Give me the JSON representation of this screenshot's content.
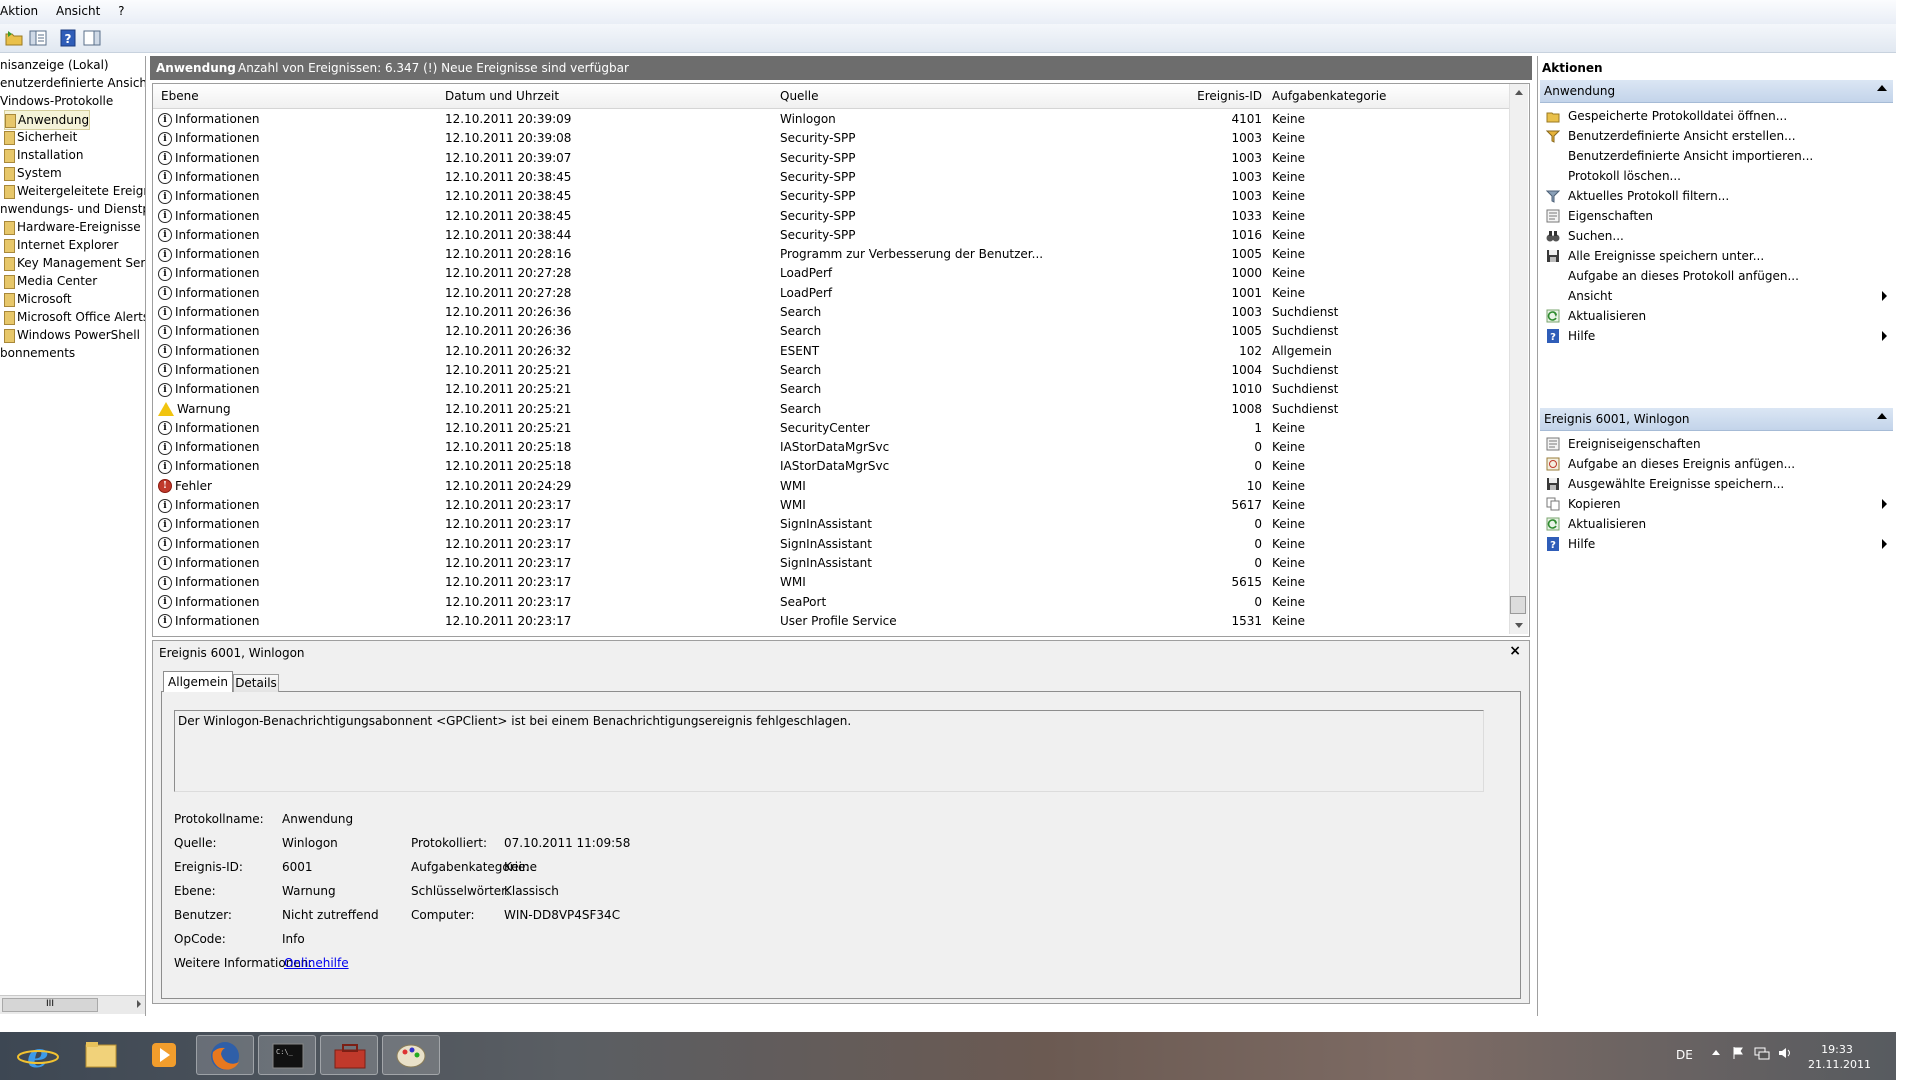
{
  "menu": [
    "Aktion",
    "Ansicht",
    "?"
  ],
  "tree": {
    "items": [
      {
        "label": "nisanzeige (Lokal)",
        "indent": 0
      },
      {
        "label": "enutzerdefinierte Ansichten",
        "indent": 0
      },
      {
        "label": "Vindows-Protokolle",
        "indent": 0
      },
      {
        "label": "Anwendung",
        "indent": 1,
        "selected": true
      },
      {
        "label": "Sicherheit",
        "indent": 1
      },
      {
        "label": "Installation",
        "indent": 1
      },
      {
        "label": "System",
        "indent": 1
      },
      {
        "label": "Weitergeleitete Ereignisse",
        "indent": 1
      },
      {
        "label": "nwendungs- und Dienstprotokolle",
        "indent": 0
      },
      {
        "label": "Hardware-Ereignisse",
        "indent": 1
      },
      {
        "label": "Internet Explorer",
        "indent": 1
      },
      {
        "label": "Key Management Service",
        "indent": 1
      },
      {
        "label": "Media Center",
        "indent": 1
      },
      {
        "label": "Microsoft",
        "indent": 1
      },
      {
        "label": "Microsoft Office Alerts",
        "indent": 1
      },
      {
        "label": "Windows PowerShell",
        "indent": 1
      },
      {
        "label": "bonnements",
        "indent": 0
      }
    ],
    "scroll_glyph": "III"
  },
  "center_header": {
    "title": "Anwendung",
    "info": "Anzahl von Ereignissen: 6.347 (!) Neue Ereignisse sind verfügbar"
  },
  "grid": {
    "columns": [
      "Ebene",
      "Datum und Uhrzeit",
      "Quelle",
      "Ereignis-ID",
      "Aufgabenkategorie"
    ],
    "rows": [
      {
        "level": "Informationen",
        "kind": "info",
        "date": "12.10.2011 20:39:09",
        "source": "Winlogon",
        "id": "4101",
        "cat": "Keine"
      },
      {
        "level": "Informationen",
        "kind": "info",
        "date": "12.10.2011 20:39:08",
        "source": "Security-SPP",
        "id": "1003",
        "cat": "Keine"
      },
      {
        "level": "Informationen",
        "kind": "info",
        "date": "12.10.2011 20:39:07",
        "source": "Security-SPP",
        "id": "1003",
        "cat": "Keine"
      },
      {
        "level": "Informationen",
        "kind": "info",
        "date": "12.10.2011 20:38:45",
        "source": "Security-SPP",
        "id": "1003",
        "cat": "Keine"
      },
      {
        "level": "Informationen",
        "kind": "info",
        "date": "12.10.2011 20:38:45",
        "source": "Security-SPP",
        "id": "1003",
        "cat": "Keine"
      },
      {
        "level": "Informationen",
        "kind": "info",
        "date": "12.10.2011 20:38:45",
        "source": "Security-SPP",
        "id": "1033",
        "cat": "Keine"
      },
      {
        "level": "Informationen",
        "kind": "info",
        "date": "12.10.2011 20:38:44",
        "source": "Security-SPP",
        "id": "1016",
        "cat": "Keine"
      },
      {
        "level": "Informationen",
        "kind": "info",
        "date": "12.10.2011 20:28:16",
        "source": "Programm zur Verbesserung der Benutzer...",
        "id": "1005",
        "cat": "Keine"
      },
      {
        "level": "Informationen",
        "kind": "info",
        "date": "12.10.2011 20:27:28",
        "source": "LoadPerf",
        "id": "1000",
        "cat": "Keine"
      },
      {
        "level": "Informationen",
        "kind": "info",
        "date": "12.10.2011 20:27:28",
        "source": "LoadPerf",
        "id": "1001",
        "cat": "Keine"
      },
      {
        "level": "Informationen",
        "kind": "info",
        "date": "12.10.2011 20:26:36",
        "source": "Search",
        "id": "1003",
        "cat": "Suchdienst"
      },
      {
        "level": "Informationen",
        "kind": "info",
        "date": "12.10.2011 20:26:36",
        "source": "Search",
        "id": "1005",
        "cat": "Suchdienst"
      },
      {
        "level": "Informationen",
        "kind": "info",
        "date": "12.10.2011 20:26:32",
        "source": "ESENT",
        "id": "102",
        "cat": "Allgemein"
      },
      {
        "level": "Informationen",
        "kind": "info",
        "date": "12.10.2011 20:25:21",
        "source": "Search",
        "id": "1004",
        "cat": "Suchdienst"
      },
      {
        "level": "Informationen",
        "kind": "info",
        "date": "12.10.2011 20:25:21",
        "source": "Search",
        "id": "1010",
        "cat": "Suchdienst"
      },
      {
        "level": "Warnung",
        "kind": "warn",
        "date": "12.10.2011 20:25:21",
        "source": "Search",
        "id": "1008",
        "cat": "Suchdienst"
      },
      {
        "level": "Informationen",
        "kind": "info",
        "date": "12.10.2011 20:25:21",
        "source": "SecurityCenter",
        "id": "1",
        "cat": "Keine"
      },
      {
        "level": "Informationen",
        "kind": "info",
        "date": "12.10.2011 20:25:18",
        "source": "IAStorDataMgrSvc",
        "id": "0",
        "cat": "Keine"
      },
      {
        "level": "Informationen",
        "kind": "info",
        "date": "12.10.2011 20:25:18",
        "source": "IAStorDataMgrSvc",
        "id": "0",
        "cat": "Keine"
      },
      {
        "level": "Fehler",
        "kind": "err",
        "date": "12.10.2011 20:24:29",
        "source": "WMI",
        "id": "10",
        "cat": "Keine"
      },
      {
        "level": "Informationen",
        "kind": "info",
        "date": "12.10.2011 20:23:17",
        "source": "WMI",
        "id": "5617",
        "cat": "Keine"
      },
      {
        "level": "Informationen",
        "kind": "info",
        "date": "12.10.2011 20:23:17",
        "source": "SignInAssistant",
        "id": "0",
        "cat": "Keine"
      },
      {
        "level": "Informationen",
        "kind": "info",
        "date": "12.10.2011 20:23:17",
        "source": "SignInAssistant",
        "id": "0",
        "cat": "Keine"
      },
      {
        "level": "Informationen",
        "kind": "info",
        "date": "12.10.2011 20:23:17",
        "source": "SignInAssistant",
        "id": "0",
        "cat": "Keine"
      },
      {
        "level": "Informationen",
        "kind": "info",
        "date": "12.10.2011 20:23:17",
        "source": "WMI",
        "id": "5615",
        "cat": "Keine"
      },
      {
        "level": "Informationen",
        "kind": "info",
        "date": "12.10.2011 20:23:17",
        "source": "SeaPort",
        "id": "0",
        "cat": "Keine"
      },
      {
        "level": "Informationen",
        "kind": "info",
        "date": "12.10.2011 20:23:17",
        "source": "User Profile Service",
        "id": "1531",
        "cat": "Keine"
      }
    ]
  },
  "detail": {
    "title": "Ereignis 6001, Winlogon",
    "close": "×",
    "tabs": [
      "Allgemein",
      "Details"
    ],
    "message": "Der Winlogon-Benachrichtigungsabonnent <GPClient> ist bei einem Benachrichtigungsereignis fehlgeschlagen.",
    "fields": {
      "protokollname_label": "Protokollname:",
      "protokollname": "Anwendung",
      "quelle_label": "Quelle:",
      "quelle": "Winlogon",
      "protokolliert_label": "Protokolliert:",
      "protokolliert": "07.10.2011 11:09:58",
      "id_label": "Ereignis-ID:",
      "id": "6001",
      "kategorie_label": "Aufgabenkategorie:",
      "kategorie": "Keine",
      "ebene_label": "Ebene:",
      "ebene": "Warnung",
      "schluessel_label": "Schlüsselwörter:",
      "schluessel": "Klassisch",
      "benutzer_label": "Benutzer:",
      "benutzer": "Nicht zutreffend",
      "computer_label": "Computer:",
      "computer": "WIN-DD8VP4SF34C",
      "opcode_label": "OpCode:",
      "opcode": "Info",
      "weitere_label": "Weitere Informationen:",
      "weitere_link": "Onlinehilfe"
    }
  },
  "actions": {
    "title": "Aktionen",
    "section1": "Anwendung",
    "items1": [
      {
        "label": "Gespeicherte Protokolldatei öffnen...",
        "icon": "folder-open-icon"
      },
      {
        "label": "Benutzerdefinierte Ansicht erstellen...",
        "icon": "filter-create-icon"
      },
      {
        "label": "Benutzerdefinierte Ansicht importieren...",
        "icon": ""
      },
      {
        "label": "Protokoll löschen...",
        "icon": ""
      },
      {
        "label": "Aktuelles Protokoll filtern...",
        "icon": "filter-icon"
      },
      {
        "label": "Eigenschaften",
        "icon": "properties-icon"
      },
      {
        "label": "Suchen...",
        "icon": "binoculars-icon"
      },
      {
        "label": "Alle Ereignisse speichern unter...",
        "icon": "save-icon"
      },
      {
        "label": "Aufgabe an dieses Protokoll anfügen...",
        "icon": ""
      },
      {
        "label": "Ansicht",
        "icon": "",
        "submenu": true
      },
      {
        "label": "Aktualisieren",
        "icon": "refresh-icon"
      },
      {
        "label": "Hilfe",
        "icon": "help-icon",
        "submenu": true
      }
    ],
    "section2": "Ereignis 6001, Winlogon",
    "items2": [
      {
        "label": "Ereigniseigenschaften",
        "icon": "properties-icon"
      },
      {
        "label": "Aufgabe an dieses Ereignis anfügen...",
        "icon": "task-icon"
      },
      {
        "label": "Ausgewählte Ereignisse speichern...",
        "icon": "save-icon"
      },
      {
        "label": "Kopieren",
        "icon": "copy-icon",
        "submenu": true
      },
      {
        "label": "Aktualisieren",
        "icon": "refresh-icon"
      },
      {
        "label": "Hilfe",
        "icon": "help-icon",
        "submenu": true
      }
    ]
  },
  "taskbar": {
    "apps": [
      "internet-explorer-icon",
      "explorer-folder-icon",
      "media-player-icon",
      "firefox-icon",
      "command-prompt-icon",
      "toolbox-icon",
      "paint-icon"
    ],
    "lang": "DE",
    "time": "19:33",
    "date": "21.11.2011"
  },
  "colors": {
    "header_gray": "#6d6d6d",
    "section_blue": "#c3d4ea",
    "link": "#0000ee"
  }
}
